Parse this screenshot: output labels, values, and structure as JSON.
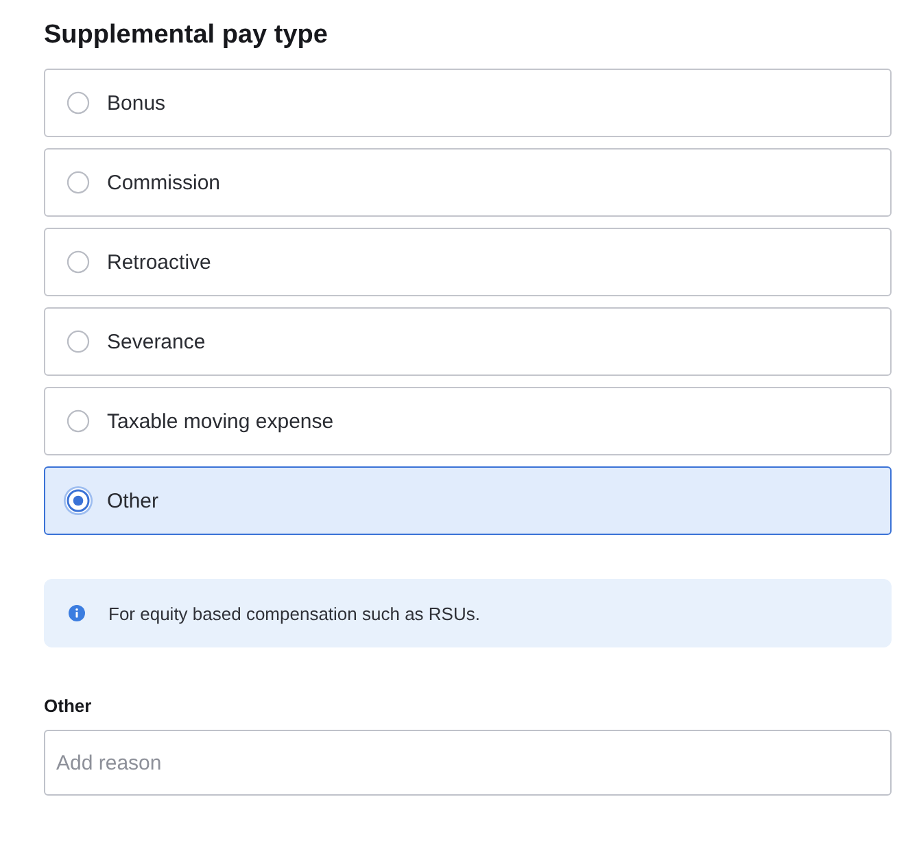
{
  "title": "Supplemental pay type",
  "options": [
    {
      "label": "Bonus",
      "selected": false
    },
    {
      "label": "Commission",
      "selected": false
    },
    {
      "label": "Retroactive",
      "selected": false
    },
    {
      "label": "Severance",
      "selected": false
    },
    {
      "label": "Taxable moving expense",
      "selected": false
    },
    {
      "label": "Other",
      "selected": true
    }
  ],
  "notice": {
    "text": "For equity based compensation such as RSUs."
  },
  "reason_field": {
    "label": "Other",
    "placeholder": "Add reason"
  }
}
